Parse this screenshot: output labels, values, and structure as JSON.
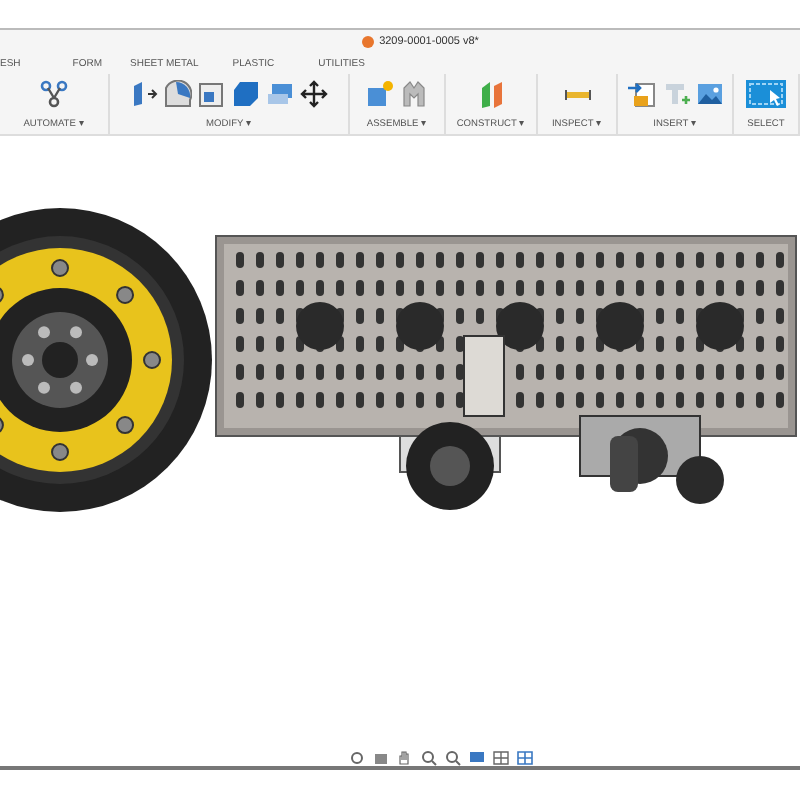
{
  "window": {
    "title": "3209-0001-0005 v8*"
  },
  "tabs": [
    {
      "label": "ESH"
    },
    {
      "label": "FORM"
    },
    {
      "label": "SHEET METAL"
    },
    {
      "label": "PLASTIC"
    },
    {
      "label": "UTILITIES"
    }
  ],
  "toolbar_groups": [
    {
      "label": "AUTOMATE ▾"
    },
    {
      "label": "MODIFY ▾"
    },
    {
      "label": "ASSEMBLE ▾"
    },
    {
      "label": "CONSTRUCT ▾"
    },
    {
      "label": "INSPECT ▾"
    },
    {
      "label": "INSERT ▾"
    },
    {
      "label": "SELECT"
    }
  ]
}
